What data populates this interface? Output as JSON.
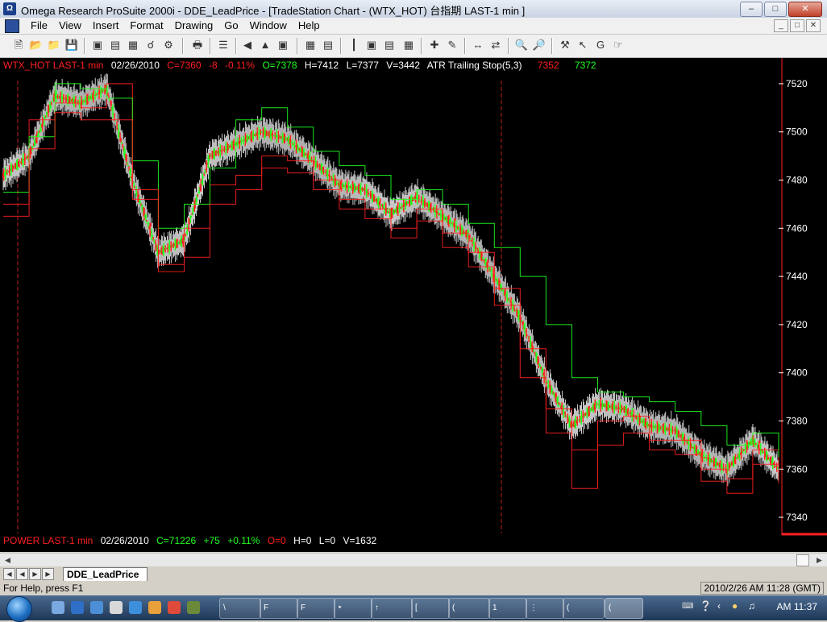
{
  "window": {
    "title": "Omega Research ProSuite 2000i - DDE_LeadPrice - [TradeStation Chart - (WTX_HOT) 台指期 LAST-1 min ]"
  },
  "menu": [
    "File",
    "View",
    "Insert",
    "Format",
    "Drawing",
    "Go",
    "Window",
    "Help"
  ],
  "info_line1": {
    "symbol": "WTX_HOT LAST-1 min",
    "date": "02/26/2010",
    "close": "C=7360",
    "change": "-8",
    "pct": "-0.11%",
    "open": "O=7378",
    "high": "H=7412",
    "low": "L=7377",
    "volume": "V=3442",
    "indicator": "ATR Trailing Stop(5,3)",
    "ind_val1": "7352",
    "ind_val2": "7372"
  },
  "info_line2": {
    "symbol": "POWER LAST-1 min",
    "date": "02/26/2010",
    "close": "C=71226",
    "change": "+75",
    "pct": "+0.11%",
    "open": "O=0",
    "high": "H=0",
    "low": "L=0",
    "volume": "V=1632"
  },
  "chart_data": {
    "type": "line",
    "y_ticks": [
      "7520",
      "7500",
      "7480",
      "7460",
      "7440",
      "7420",
      "7400",
      "7380",
      "7360",
      "7340"
    ],
    "ylim": [
      7334,
      7526
    ],
    "x": [
      0,
      10,
      20,
      30,
      40,
      50,
      60,
      70,
      80,
      90,
      100,
      110,
      120,
      130,
      140,
      150,
      160,
      170,
      180,
      190,
      200,
      210,
      220,
      230,
      240,
      250,
      260,
      270,
      280,
      290,
      300
    ],
    "series": [
      {
        "values": [
          7482,
          7490,
          7515,
          7512,
          7518,
          7480,
          7450,
          7455,
          7490,
          7495,
          7500,
          7497,
          7488,
          7478,
          7476,
          7466,
          7473,
          7465,
          7457,
          7440,
          7423,
          7397,
          7378,
          7387,
          7385,
          7378,
          7376,
          7366,
          7360,
          7372,
          7360
        ]
      },
      {
        "values": [
          7470,
          7505,
          7512,
          7510,
          7520,
          7472,
          7445,
          7460,
          7478,
          7482,
          7490,
          7488,
          7480,
          7472,
          7468,
          7460,
          7468,
          7458,
          7450,
          7435,
          7410,
          7385,
          7368,
          7380,
          7382,
          7372,
          7372,
          7360,
          7356,
          7368,
          7358
        ]
      },
      {
        "values": [
          7475,
          7498,
          7520,
          7518,
          7514,
          7488,
          7460,
          7470,
          7485,
          7505,
          7510,
          7502,
          7492,
          7486,
          7482,
          7472,
          7476,
          7470,
          7462,
          7452,
          7440,
          7420,
          7398,
          7392,
          7390,
          7388,
          7384,
          7378,
          7370,
          7375,
          7365
        ]
      },
      {
        "values": [
          7465,
          7493,
          7508,
          7505,
          7505,
          7476,
          7442,
          7448,
          7470,
          7476,
          7485,
          7483,
          7476,
          7468,
          7464,
          7456,
          7463,
          7452,
          7444,
          7428,
          7398,
          7375,
          7352,
          7370,
          7375,
          7368,
          7366,
          7355,
          7350,
          7362,
          7354
        ]
      }
    ]
  },
  "tab": {
    "label": "DDE_LeadPrice"
  },
  "status": {
    "help": "For Help, press F1",
    "datetime": "2010/2/26 AM 11:28 (GMT)"
  },
  "taskbar": {
    "clock": "AM 11:37"
  }
}
